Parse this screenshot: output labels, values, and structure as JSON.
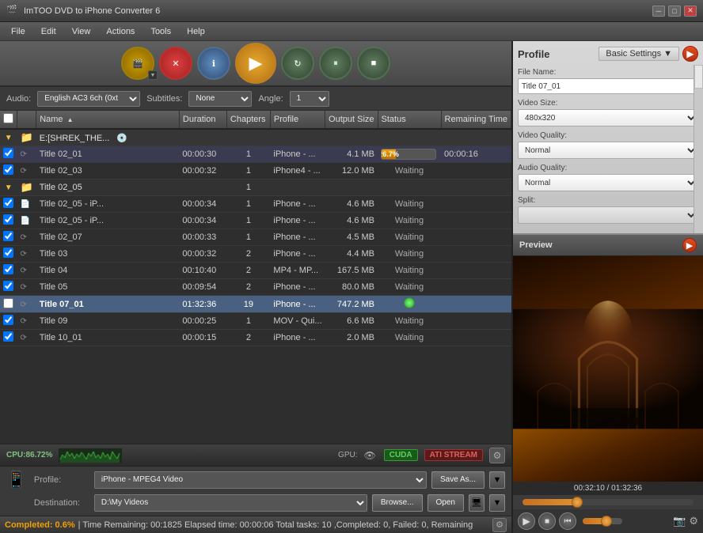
{
  "app": {
    "title": "ImTOO DVD to iPhone Converter 6",
    "icon": "🎬"
  },
  "titlebar": {
    "minimize": "─",
    "maximize": "□",
    "close": "✕"
  },
  "menu": {
    "items": [
      "File",
      "Edit",
      "View",
      "Actions",
      "Tools",
      "Help"
    ]
  },
  "toolbar": {
    "buttons": [
      {
        "id": "add",
        "icon": "⊕",
        "label": "Add"
      },
      {
        "id": "stop",
        "icon": "✕",
        "label": "Stop"
      },
      {
        "id": "info",
        "icon": "ℹ",
        "label": "Info"
      },
      {
        "id": "convert",
        "icon": "▶▶",
        "label": "Convert"
      },
      {
        "id": "refresh",
        "icon": "↻",
        "label": "Refresh"
      },
      {
        "id": "pause",
        "icon": "⏸",
        "label": "Pause"
      },
      {
        "id": "stop2",
        "icon": "■",
        "label": "Stop"
      }
    ]
  },
  "media_bar": {
    "audio_label": "Audio:",
    "audio_value": "English AC3 6ch (0xt▼",
    "subtitle_label": "Subtitles:",
    "subtitle_value": "None",
    "angle_label": "Angle:",
    "angle_value": "1"
  },
  "table": {
    "columns": [
      "",
      "",
      "Name",
      "Duration",
      "Chapters",
      "Profile",
      "Output Size",
      "Status",
      "Remaining Time"
    ],
    "rows": [
      {
        "type": "group",
        "check": false,
        "name": "E:[SHREK_THE...",
        "duration": "",
        "chapters": "",
        "profile": "",
        "outsize": "",
        "status": "",
        "remaining": "",
        "indent": 0
      },
      {
        "type": "file",
        "check": true,
        "name": "Title 02_01",
        "duration": "00:00:30",
        "chapters": "1",
        "profile": "iPhone - ...",
        "outsize": "4.1 MB",
        "status": "progress",
        "progress": "26.7%",
        "remaining": "00:00:16",
        "indent": 1
      },
      {
        "type": "file",
        "check": true,
        "name": "Title 02_03",
        "duration": "00:00:32",
        "chapters": "1",
        "profile": "iPhone4 - ...",
        "outsize": "12.0 MB",
        "status": "Waiting",
        "remaining": "",
        "indent": 1
      },
      {
        "type": "group2",
        "check": false,
        "name": "Title 02_05",
        "duration": "",
        "chapters": "1",
        "profile": "",
        "outsize": "",
        "status": "",
        "remaining": "",
        "indent": 1
      },
      {
        "type": "file",
        "check": true,
        "name": "Title 02_05 - iP...",
        "duration": "00:00:34",
        "chapters": "1",
        "profile": "iPhone - ...",
        "outsize": "4.6 MB",
        "status": "Waiting",
        "remaining": "",
        "indent": 2
      },
      {
        "type": "file",
        "check": true,
        "name": "Title 02_05 - iP...",
        "duration": "00:00:34",
        "chapters": "1",
        "profile": "iPhone - ...",
        "outsize": "4.6 MB",
        "status": "Waiting",
        "remaining": "",
        "indent": 2
      },
      {
        "type": "file",
        "check": true,
        "name": "Title 02_07",
        "duration": "00:00:33",
        "chapters": "1",
        "profile": "iPhone - ...",
        "outsize": "4.5 MB",
        "status": "Waiting",
        "remaining": "",
        "indent": 1
      },
      {
        "type": "file",
        "check": true,
        "name": "Title 03",
        "duration": "00:00:32",
        "chapters": "2",
        "profile": "iPhone - ...",
        "outsize": "4.4 MB",
        "status": "Waiting",
        "remaining": "",
        "indent": 1
      },
      {
        "type": "file",
        "check": true,
        "name": "Title 04",
        "duration": "00:10:40",
        "chapters": "2",
        "profile": "MP4 - MP...",
        "outsize": "167.5 MB",
        "status": "Waiting",
        "remaining": "",
        "indent": 1
      },
      {
        "type": "file",
        "check": true,
        "name": "Title 05",
        "duration": "00:09:54",
        "chapters": "2",
        "profile": "iPhone - ...",
        "outsize": "80.0 MB",
        "status": "Waiting",
        "remaining": "",
        "indent": 1
      },
      {
        "type": "file-selected",
        "check": false,
        "name": "Title 07_01",
        "duration": "01:32:36",
        "chapters": "19",
        "profile": "iPhone - ...",
        "outsize": "747.2 MB",
        "status": "green",
        "remaining": "",
        "indent": 1
      },
      {
        "type": "file",
        "check": true,
        "name": "Title 09",
        "duration": "00:00:25",
        "chapters": "1",
        "profile": "MOV - Qui...",
        "outsize": "6.6 MB",
        "status": "Waiting",
        "remaining": "",
        "indent": 1
      },
      {
        "type": "file",
        "check": true,
        "name": "Title 10_01",
        "duration": "00:00:15",
        "chapters": "2",
        "profile": "iPhone - ...",
        "outsize": "2.0 MB",
        "status": "Waiting",
        "remaining": "",
        "indent": 1
      }
    ]
  },
  "cpu": {
    "label": "CPU:86.72%",
    "gpu_label": "GPU:",
    "cuda": "CUDA",
    "ati": "ATI STREAM"
  },
  "profile_bar": {
    "profile_label": "Profile:",
    "profile_value": "iPhone - MPEG4 Video",
    "save_as": "Save As...",
    "destination_label": "Destination:",
    "destination_value": "D:\\My Videos",
    "browse": "Browse...",
    "open": "Open"
  },
  "status_bar": {
    "text": "Completed: 0.6%  |  Time Remaining: 00:1825  Elapsed time: 00:00:06  Total tasks: 10 ,Completed: 0, Failed: 0, Remaining"
  },
  "right_panel": {
    "settings": {
      "title": "Profile",
      "mode_label": "Basic Settings",
      "file_name_label": "File Name:",
      "file_name_value": "Title 07_01",
      "video_size_label": "Video Size:",
      "video_size_value": "480x320",
      "video_quality_label": "Video Quality:",
      "video_quality_value": "Normal",
      "audio_quality_label": "Audio Quality:",
      "audio_quality_value": "Normal",
      "split_label": "Split:"
    },
    "preview": {
      "title": "Preview",
      "time_current": "00:32:10",
      "time_total": "01:32:36",
      "time_display": "00:32:10 / 01:32:36",
      "progress_pct": 32
    }
  }
}
